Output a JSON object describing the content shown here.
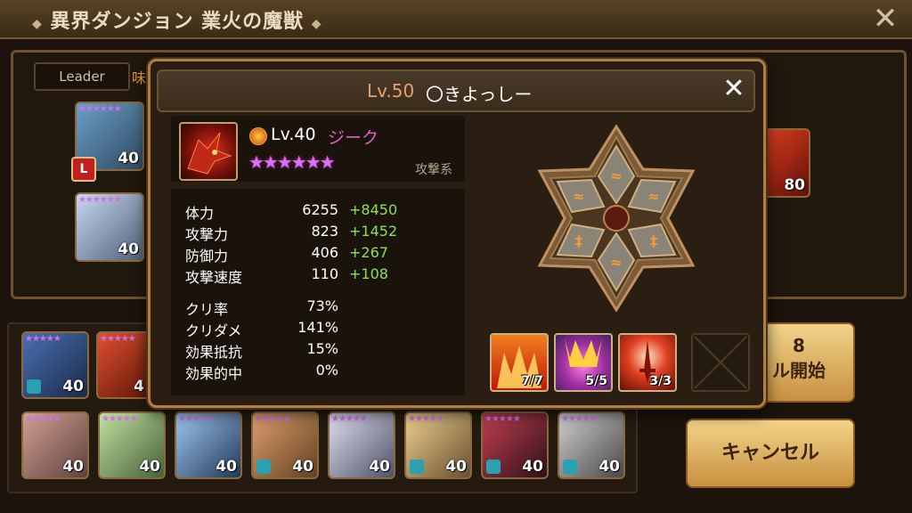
{
  "header": {
    "title": "異界ダンジョン 業火の魔獣"
  },
  "team_panel": {
    "leader_label": "Leader",
    "ally_label": "味",
    "units": [
      {
        "level": "40",
        "stars": "★★★★★★"
      },
      {
        "level": "40",
        "stars": "★★★★★★"
      },
      {
        "level": "80",
        "stars": ""
      }
    ]
  },
  "bench": [
    {
      "level": "40"
    },
    {
      "level": "4"
    },
    {
      "level": "40"
    },
    {
      "level": "40"
    },
    {
      "level": "40"
    },
    {
      "level": "40"
    },
    {
      "level": "40"
    },
    {
      "level": "40"
    },
    {
      "level": "40"
    },
    {
      "level": "40"
    }
  ],
  "buttons": {
    "start_count": "8",
    "start_label": "ル開始",
    "cancel_label": "キャンセル"
  },
  "modal": {
    "player_level": "Lv.50",
    "player_name": "〇きよっしー",
    "monster": {
      "level": "Lv.40",
      "name": "ジーク",
      "stars": "★★★★★★",
      "type": "攻撃系"
    },
    "stats": [
      {
        "label": "体力",
        "value": "6255",
        "bonus": "+8450"
      },
      {
        "label": "攻撃力",
        "value": "823",
        "bonus": "+1452"
      },
      {
        "label": "防御力",
        "value": "406",
        "bonus": "+267"
      },
      {
        "label": "攻撃速度",
        "value": "110",
        "bonus": "+108"
      }
    ],
    "substats": [
      {
        "label": "クリ率",
        "value": "73%"
      },
      {
        "label": "クリダメ",
        "value": "141%"
      },
      {
        "label": "効果抵抗",
        "value": "15%"
      },
      {
        "label": "効果的中",
        "value": "0%"
      }
    ],
    "skills": [
      {
        "count": "7/7"
      },
      {
        "count": "5/5"
      },
      {
        "count": "3/3"
      }
    ]
  }
}
